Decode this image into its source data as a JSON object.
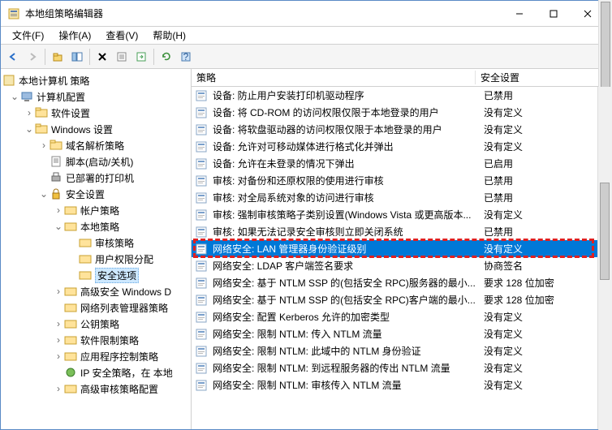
{
  "window": {
    "title": "本地组策略编辑器"
  },
  "menu": {
    "file": "文件(F)",
    "action": "操作(A)",
    "view": "查看(V)",
    "help": "帮助(H)"
  },
  "tree": {
    "root": "本地计算机 策略",
    "n1": "计算机配置",
    "n2": "软件设置",
    "n3": "Windows 设置",
    "n4": "域名解析策略",
    "n5": "脚本(启动/关机)",
    "n6": "已部署的打印机",
    "n7": "安全设置",
    "n8": "帐户策略",
    "n9": "本地策略",
    "n10": "审核策略",
    "n11": "用户权限分配",
    "n12": "安全选项",
    "n13": "高级安全 Windows D",
    "n14": "网络列表管理器策略",
    "n15": "公钥策略",
    "n16": "软件限制策略",
    "n17": "应用程序控制策略",
    "n18": "IP 安全策略，在 本地",
    "n19": "高级审核策略配置"
  },
  "cols": {
    "policy": "策略",
    "setting": "安全设置"
  },
  "rows": [
    {
      "p": "设备: 防止用户安装打印机驱动程序",
      "s": "已禁用"
    },
    {
      "p": "设备: 将 CD-ROM 的访问权限仅限于本地登录的用户",
      "s": "没有定义"
    },
    {
      "p": "设备: 将软盘驱动器的访问权限仅限于本地登录的用户",
      "s": "没有定义"
    },
    {
      "p": "设备: 允许对可移动媒体进行格式化并弹出",
      "s": "没有定义"
    },
    {
      "p": "设备: 允许在未登录的情况下弹出",
      "s": "已启用"
    },
    {
      "p": "审核: 对备份和还原权限的使用进行审核",
      "s": "已禁用"
    },
    {
      "p": "审核: 对全局系统对象的访问进行审核",
      "s": "已禁用"
    },
    {
      "p": "审核: 强制审核策略子类别设置(Windows Vista 或更高版本...",
      "s": "没有定义"
    },
    {
      "p": "审核: 如果无法记录安全审核则立即关闭系统",
      "s": "已禁用"
    },
    {
      "p": "网络安全: LAN 管理器身份验证级别",
      "s": "没有定义",
      "sel": true
    },
    {
      "p": "网络安全: LDAP 客户端签名要求",
      "s": "协商签名"
    },
    {
      "p": "网络安全: 基于 NTLM SSP 的(包括安全 RPC)服务器的最小...",
      "s": "要求 128 位加密"
    },
    {
      "p": "网络安全: 基于 NTLM SSP 的(包括安全 RPC)客户端的最小...",
      "s": "要求 128 位加密"
    },
    {
      "p": "网络安全: 配置 Kerberos 允许的加密类型",
      "s": "没有定义"
    },
    {
      "p": "网络安全: 限制 NTLM: 传入 NTLM 流量",
      "s": "没有定义"
    },
    {
      "p": "网络安全: 限制 NTLM: 此域中的 NTLM 身份验证",
      "s": "没有定义"
    },
    {
      "p": "网络安全: 限制 NTLM: 到远程服务器的传出 NTLM 流量",
      "s": "没有定义"
    },
    {
      "p": "网络安全: 限制 NTLM: 审核传入 NTLM 流量",
      "s": "没有定义"
    }
  ]
}
